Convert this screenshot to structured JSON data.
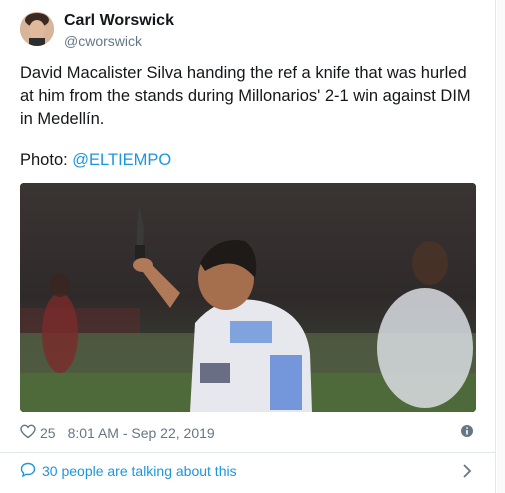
{
  "author": {
    "name": "Carl Worswick",
    "handle": "@cworswick"
  },
  "tweet": {
    "text": "David Macalister Silva handing the ref a knife that was hurled at him from the stands during Millonarios' 2-1 win against DIM in Medellín.",
    "photo_prefix": "Photo: ",
    "photo_credit": "@ELTIEMPO"
  },
  "footer": {
    "likes": "25",
    "timestamp": "8:01 AM - Sep 22, 2019",
    "talking": "30 people are talking about this"
  },
  "icons": {
    "like": "heart-outline-icon",
    "info": "info-icon",
    "talking": "speech-bubble-icon",
    "more": "chevron-right-icon"
  },
  "colors": {
    "link": "#1b95e0",
    "text": "#14171a",
    "muted": "#657786",
    "border": "#e1e8ed"
  }
}
